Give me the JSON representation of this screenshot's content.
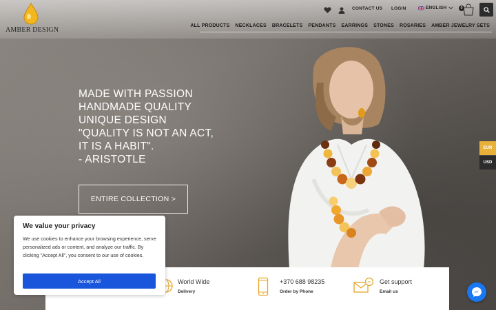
{
  "brand": {
    "logo_text": "AMBER DESIGN"
  },
  "topbar": {
    "contact_label": "CONTACT US",
    "login_label": "LOGIN",
    "language_label": "ENGLISH",
    "cart_count": "0"
  },
  "nav": {
    "items": [
      "ALL PRODUCTS",
      "NECKLACES",
      "BRACELETS",
      "PENDANTS",
      "EARRINGS",
      "STONES",
      "ROSARIES",
      "AMBER JEWELRY SETS"
    ]
  },
  "hero": {
    "lines": [
      "MADE WITH PASSION",
      "HANDMADE QUALITY",
      "UNIQUE DESIGN",
      "\"QUALITY IS NOT AN ACT,",
      "IT IS A HABIT\".",
      "- ARISTOTLE"
    ],
    "cta_label": "ENTIRE COLLECTION >"
  },
  "currency": {
    "eur": "EUR",
    "usd": "USD",
    "active": "EUR"
  },
  "features": [
    {
      "title": "World Wide",
      "subtitle": "Delivery",
      "icon": "globe-icon"
    },
    {
      "title": "+370 688 98235",
      "subtitle": "Order by Phone",
      "icon": "phone-icon"
    },
    {
      "title": "Get support",
      "subtitle": "Email us",
      "icon": "email-icon"
    }
  ],
  "cookie": {
    "title": "We value your privacy",
    "text": "We use cookies to enhance your browsing experience, serve personalized ads or content, and analyze our traffic. By clicking \"Accept All\", you consent to our use of cookies.",
    "accept_label": "Accept All"
  },
  "colors": {
    "accent": "#e8b23a",
    "cookie_button": "#1a56db",
    "messenger": "#1877f2"
  }
}
